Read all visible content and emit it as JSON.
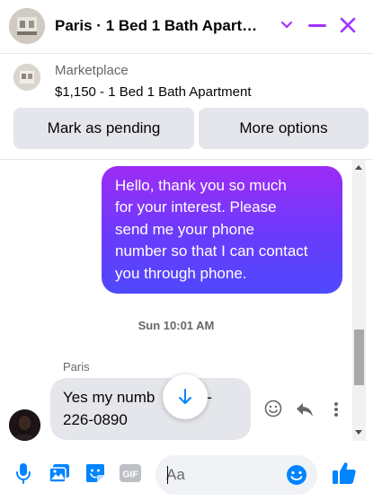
{
  "header": {
    "title": "Paris · 1 Bed 1 Bath Apartm…",
    "avatar_icon": "listing-photo",
    "chevron_icon": "chevron-down-icon",
    "minimize_icon": "minimize-icon",
    "close_icon": "close-icon",
    "accent_color": "#a033ff"
  },
  "marketplace": {
    "label": "Marketplace",
    "listing": "$1,150 - 1 Bed 1 Bath Apartment",
    "mark_pending_label": "Mark as pending",
    "more_options_label": "More options"
  },
  "conversation": {
    "outgoing_lines": [
      "Hello, thank you so much",
      "for your interest. Please",
      "send me your phone",
      "number so that I can contact",
      "you through phone."
    ],
    "timestamp": "Sun 10:01 AM",
    "incoming_sender": "Paris",
    "incoming_lines": [
      "Yes my numb",
      "54-",
      "226-0890"
    ]
  },
  "composer": {
    "placeholder": "Aa",
    "icons": [
      "mic-icon",
      "photo-icon",
      "sticker-icon",
      "gif-icon",
      "emoji-icon",
      "like-icon"
    ],
    "icon_color": "#0084ff",
    "gif_label": "GIF"
  }
}
